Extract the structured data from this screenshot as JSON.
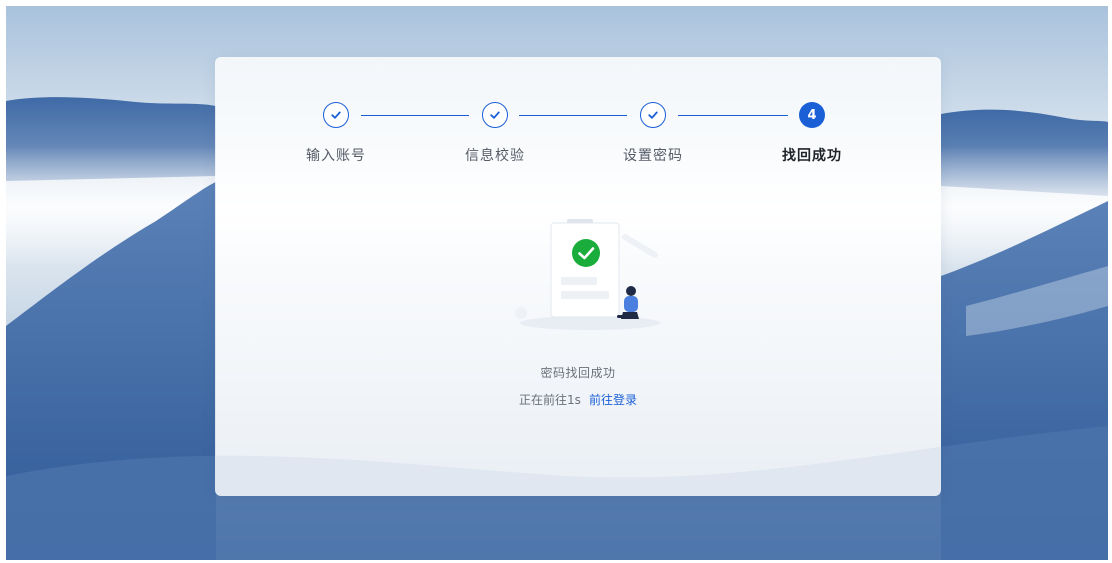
{
  "steps": [
    {
      "label": "输入账号",
      "status": "done"
    },
    {
      "label": "信息校验",
      "status": "done"
    },
    {
      "label": "设置密码",
      "status": "done"
    },
    {
      "label": "找回成功",
      "status": "active",
      "number": "4"
    }
  ],
  "result": {
    "title": "密码找回成功",
    "countdown_text": "正在前往1s",
    "login_link": "前往登录"
  },
  "colors": {
    "accent": "#1a5fd6",
    "success": "#1aad3b"
  },
  "icons": {
    "step_done": "check-icon",
    "success": "success-check-icon"
  }
}
